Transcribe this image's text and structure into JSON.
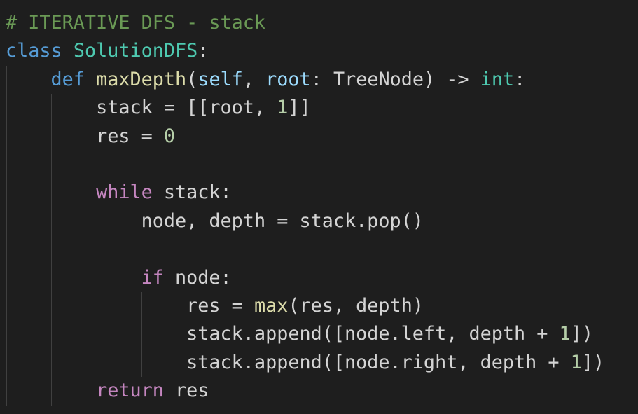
{
  "editor": {
    "theme": {
      "background": "#1e1e1e",
      "foreground": "#d4d4d4",
      "comment": "#6a9955",
      "keyword": "#569cd6",
      "control": "#c586c0",
      "class": "#4ec9b0",
      "function": "#dcdcaa",
      "parameter": "#9cdcfe",
      "number": "#b5cea8",
      "indent_guide": "#404040"
    },
    "lines": [
      {
        "indent": 0,
        "tokens": [
          {
            "t": "# ITERATIVE DFS - stack",
            "k": "comment"
          }
        ]
      },
      {
        "indent": 0,
        "tokens": [
          {
            "t": "class",
            "k": "keyword"
          },
          {
            "t": " ",
            "k": "plain"
          },
          {
            "t": "SolutionDFS",
            "k": "class"
          },
          {
            "t": ":",
            "k": "plain"
          }
        ]
      },
      {
        "indent": 4,
        "tokens": [
          {
            "t": "def",
            "k": "keyword"
          },
          {
            "t": " ",
            "k": "plain"
          },
          {
            "t": "maxDepth",
            "k": "func"
          },
          {
            "t": "(",
            "k": "plain"
          },
          {
            "t": "self",
            "k": "param"
          },
          {
            "t": ", ",
            "k": "plain"
          },
          {
            "t": "root",
            "k": "param"
          },
          {
            "t": ": TreeNode) -> ",
            "k": "plain"
          },
          {
            "t": "int",
            "k": "class"
          },
          {
            "t": ":",
            "k": "plain"
          }
        ]
      },
      {
        "indent": 8,
        "tokens": [
          {
            "t": "stack = [[root, ",
            "k": "plain"
          },
          {
            "t": "1",
            "k": "num"
          },
          {
            "t": "]]",
            "k": "plain"
          }
        ]
      },
      {
        "indent": 8,
        "tokens": [
          {
            "t": "res = ",
            "k": "plain"
          },
          {
            "t": "0",
            "k": "num"
          }
        ]
      },
      {
        "indent": 0,
        "tokens": []
      },
      {
        "indent": 8,
        "tokens": [
          {
            "t": "while",
            "k": "control"
          },
          {
            "t": " stack:",
            "k": "plain"
          }
        ]
      },
      {
        "indent": 12,
        "tokens": [
          {
            "t": "node, depth = stack.pop()",
            "k": "plain"
          }
        ]
      },
      {
        "indent": 0,
        "tokens": []
      },
      {
        "indent": 12,
        "tokens": [
          {
            "t": "if",
            "k": "control"
          },
          {
            "t": " node:",
            "k": "plain"
          }
        ]
      },
      {
        "indent": 16,
        "tokens": [
          {
            "t": "res = ",
            "k": "plain"
          },
          {
            "t": "max",
            "k": "func"
          },
          {
            "t": "(res, depth)",
            "k": "plain"
          }
        ]
      },
      {
        "indent": 16,
        "tokens": [
          {
            "t": "stack.append([node.left, depth + ",
            "k": "plain"
          },
          {
            "t": "1",
            "k": "num"
          },
          {
            "t": "])",
            "k": "plain"
          }
        ]
      },
      {
        "indent": 16,
        "tokens": [
          {
            "t": "stack.append([node.right, depth + ",
            "k": "plain"
          },
          {
            "t": "1",
            "k": "num"
          },
          {
            "t": "])",
            "k": "plain"
          }
        ]
      },
      {
        "indent": 8,
        "tokens": [
          {
            "t": "return",
            "k": "control"
          },
          {
            "t": " res",
            "k": "plain"
          }
        ]
      }
    ]
  }
}
